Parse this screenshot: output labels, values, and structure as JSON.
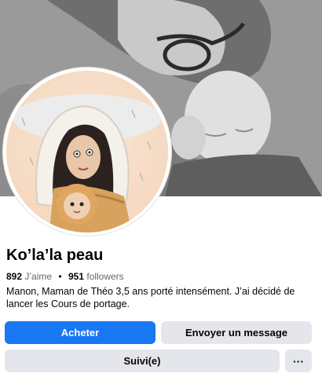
{
  "cover": {
    "description_icon": "cover-photo"
  },
  "profile": {
    "avatar_icon": "illustrated-mother-and-baby-avatar",
    "name": "Ko’la’la peau",
    "likes_count": "892",
    "likes_label": "J’aime",
    "separator": "•",
    "followers_count": "951",
    "followers_label": "followers",
    "bio": "Manon, Maman de Théo 3,5 ans porté intensément. J’ai décidé de lancer les Cours de portage."
  },
  "actions": {
    "buy_label": "Acheter",
    "message_label": "Envoyer un message",
    "following_label": "Suivi(e)",
    "more_label": "···"
  },
  "colors": {
    "primary": "#1877f2",
    "secondary_button": "#e4e6eb",
    "text": "#050505",
    "muted_text": "#65676b"
  }
}
